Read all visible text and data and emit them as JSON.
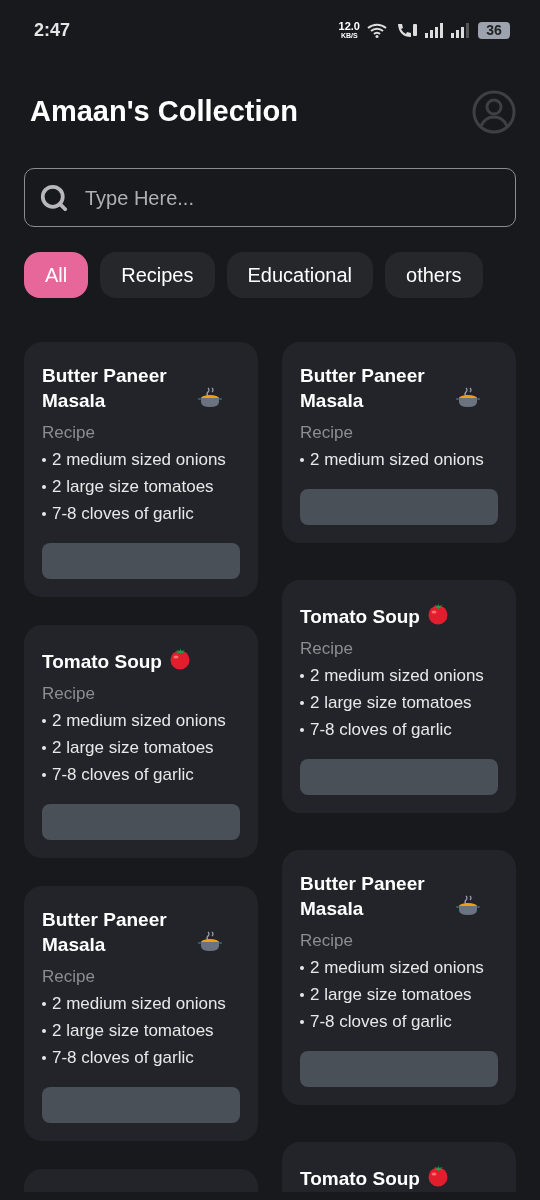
{
  "status_bar": {
    "time": "2:47",
    "speed": "12.0",
    "speed_unit": "KB/S",
    "battery": "36"
  },
  "header": {
    "title": "Amaan's Collection"
  },
  "search": {
    "placeholder": "Type Here..."
  },
  "filters": [
    {
      "label": "All",
      "selected": true
    },
    {
      "label": "Recipes",
      "selected": false
    },
    {
      "label": "Educational",
      "selected": false
    },
    {
      "label": "others",
      "selected": false
    }
  ],
  "columns": [
    [
      {
        "kind": "curry",
        "title": "Butter Paneer Masala",
        "category": "Recipe",
        "items": [
          "2 medium sized onions",
          "2 large size tomatoes",
          "7-8 cloves of garlic"
        ]
      },
      {
        "kind": "soup",
        "title": "Tomato Soup",
        "category": "Recipe",
        "items": [
          "2 medium sized onions",
          "2 large size tomatoes",
          "7-8 cloves of garlic"
        ]
      },
      {
        "kind": "curry",
        "title": "Butter Paneer Masala",
        "category": "Recipe",
        "items": [
          "2 medium sized onions",
          "2 large size tomatoes",
          "7-8 cloves of garlic"
        ]
      },
      {
        "kind": "stub"
      }
    ],
    [
      {
        "kind": "curry",
        "title": "Butter Paneer Masala",
        "category": "Recipe",
        "items": [
          "2 medium sized onions"
        ]
      },
      {
        "kind": "soup",
        "title": "Tomato Soup",
        "category": "Recipe",
        "items": [
          "2 medium sized onions",
          "2 large size tomatoes",
          "7-8 cloves of garlic"
        ]
      },
      {
        "kind": "curry",
        "title": "Butter Paneer Masala",
        "category": "Recipe",
        "items": [
          "2 medium sized onions",
          "2 large size tomatoes",
          "7-8 cloves of garlic"
        ]
      },
      {
        "kind": "soup",
        "title": "Tomato Soup"
      }
    ]
  ]
}
